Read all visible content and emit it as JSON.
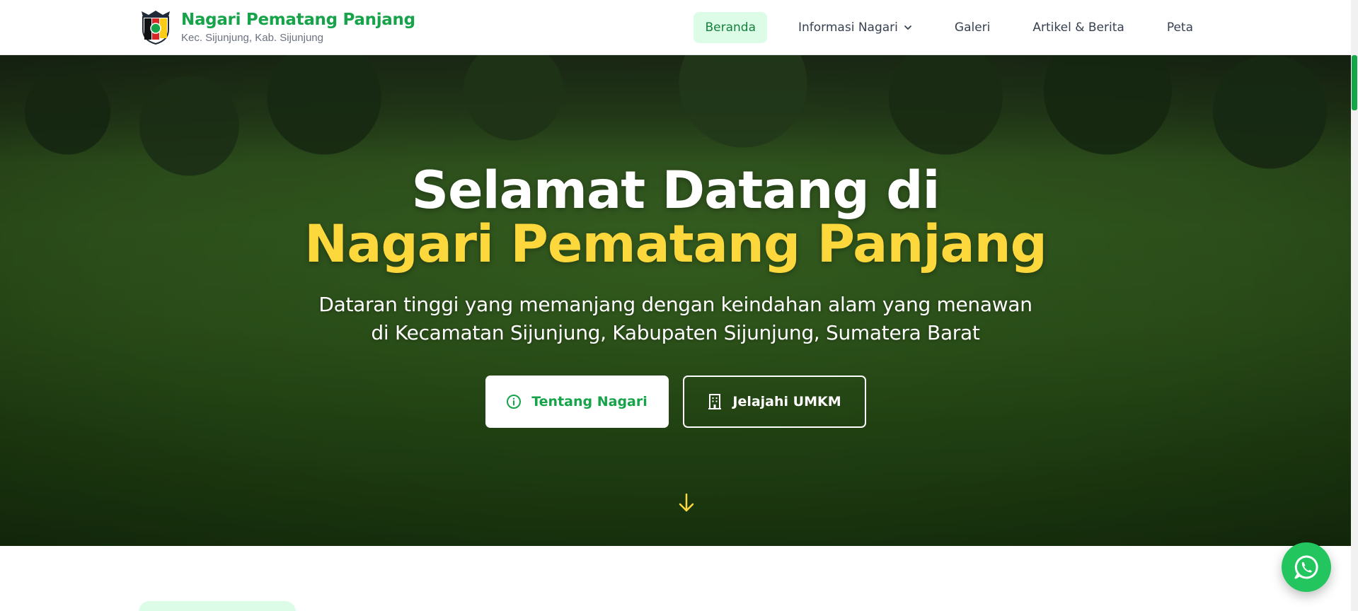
{
  "header": {
    "title": "Nagari Pematang Panjang",
    "subtitle": "Kec. Sijunjung, Kab. Sijunjung"
  },
  "nav": {
    "items": [
      {
        "label": "Beranda",
        "active": true
      },
      {
        "label": "Informasi Nagari",
        "dropdown": true
      },
      {
        "label": "Galeri"
      },
      {
        "label": "Artikel & Berita"
      },
      {
        "label": "Peta"
      }
    ]
  },
  "hero": {
    "title_line1": "Selamat Datang di",
    "title_line2": "Nagari Pematang Panjang",
    "desc_line1": "Dataran tinggi yang memanjang dengan keindahan alam yang menawan",
    "desc_line2": "di Kecamatan Sijunjung, Kabupaten Sijunjung, Sumatera Barat",
    "buttons": {
      "primary": {
        "label": "Tentang Nagari",
        "icon": "info-icon"
      },
      "secondary": {
        "label": "Jelajahi UMKM",
        "icon": "building-icon"
      }
    }
  },
  "colors": {
    "brand_green": "#16a34a",
    "accent_yellow": "#fcd83d",
    "whatsapp": "#22c55e"
  }
}
